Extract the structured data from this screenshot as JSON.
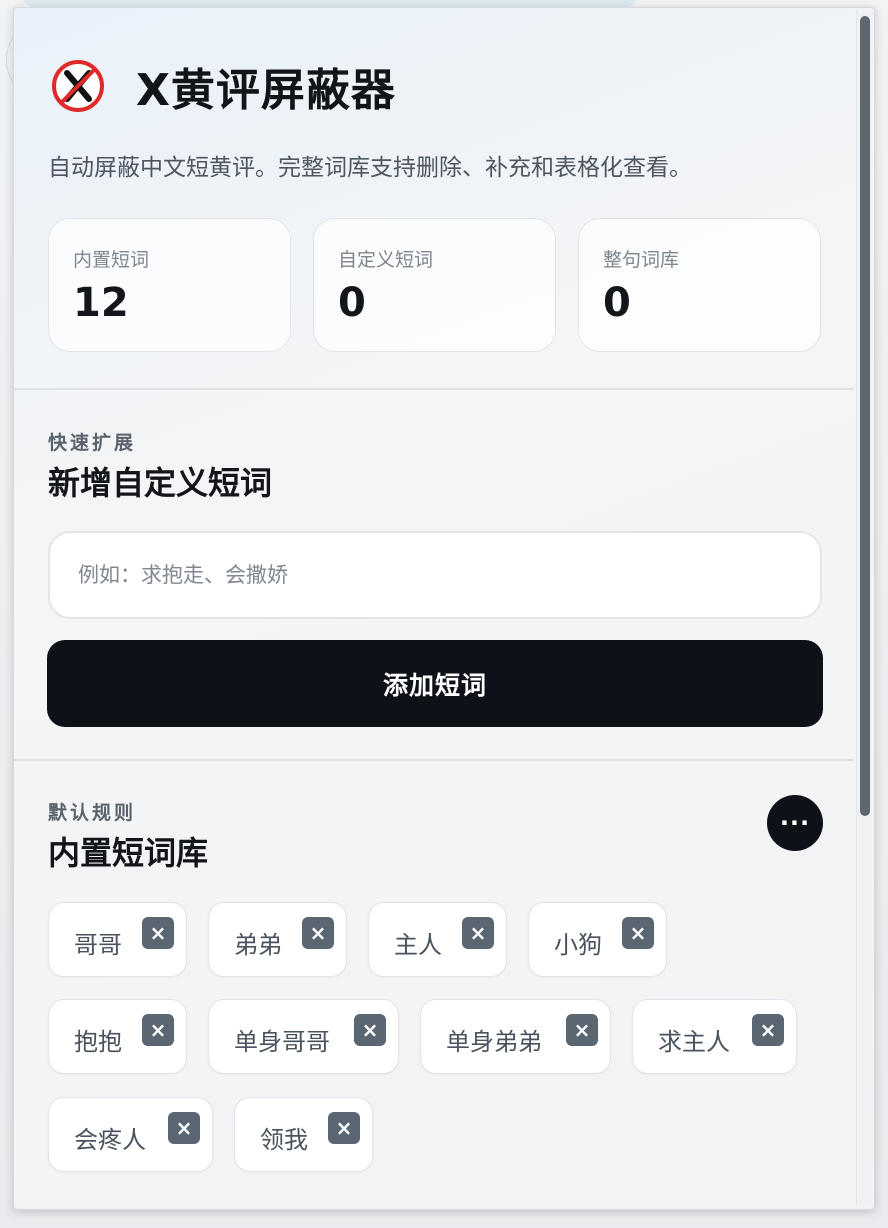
{
  "app": {
    "title": "X黄评屏蔽器",
    "subtitle": "自动屏蔽中文短黄评。完整词库支持删除、补充和表格化查看。"
  },
  "stats": [
    {
      "label": "内置短词",
      "value": "12"
    },
    {
      "label": "自定义短词",
      "value": "0"
    },
    {
      "label": "整句词库",
      "value": "0"
    }
  ],
  "add_section": {
    "eyebrow": "快速扩展",
    "title": "新增自定义短词",
    "input_placeholder": "例如：求抱走、会撒娇",
    "input_value": "",
    "button_label": "添加短词"
  },
  "builtin_section": {
    "eyebrow": "默认规则",
    "title": "内置短词库",
    "more_label": "···",
    "chips": [
      "哥哥",
      "弟弟",
      "主人",
      "小狗",
      "抱抱",
      "单身哥哥",
      "单身弟弟",
      "求主人",
      "会疼人",
      "领我"
    ],
    "remove_icon": "close-icon",
    "remove_glyph": "×"
  },
  "colors": {
    "primary_button": "#0e1218",
    "chip_remove": "#5a6672",
    "logo_red": "#e02a2a"
  }
}
